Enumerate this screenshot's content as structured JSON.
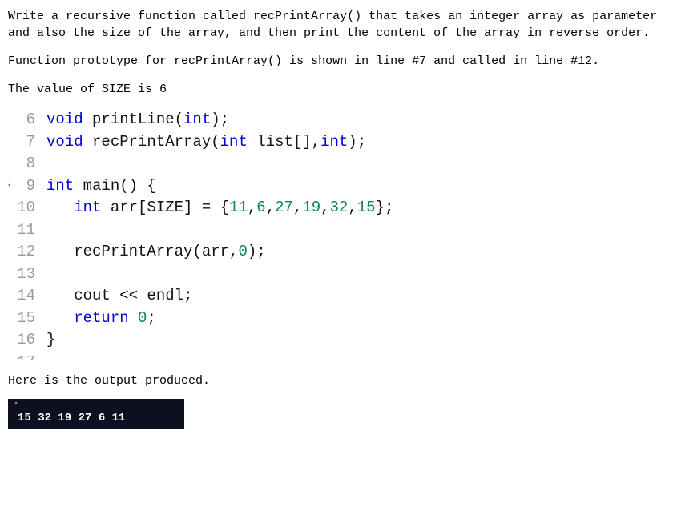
{
  "problem": {
    "p1": "Write a recursive function called recPrintArray() that takes an integer array as parameter and also the size of the array, and then print the content of the array in reverse order.",
    "p2": "Function prototype for recPrintArray() is shown in line #7 and called in line #12.",
    "p3": "The value of SIZE is 6"
  },
  "code": {
    "lines": [
      {
        "n": "6",
        "c": [
          [
            "kw",
            "void"
          ],
          [
            "",
            " printLine("
          ],
          [
            "kw",
            "int"
          ],
          [
            "",
            ");"
          ]
        ]
      },
      {
        "n": "7",
        "c": [
          [
            "kw",
            "void"
          ],
          [
            "",
            " recPrintArray("
          ],
          [
            "kw",
            "int"
          ],
          [
            "",
            " list[],"
          ],
          [
            "kw",
            "int"
          ],
          [
            "",
            ");"
          ]
        ]
      },
      {
        "n": "8",
        "c": [
          [
            "",
            ""
          ]
        ]
      },
      {
        "n": "9",
        "fold": true,
        "c": [
          [
            "kw",
            "int"
          ],
          [
            "",
            " main() {"
          ]
        ]
      },
      {
        "n": "10",
        "c": [
          [
            "",
            "   "
          ],
          [
            "kw",
            "int"
          ],
          [
            "",
            " arr[SIZE] = {"
          ],
          [
            "num",
            "11"
          ],
          [
            "",
            ","
          ],
          [
            "num",
            "6"
          ],
          [
            "",
            ","
          ],
          [
            "num",
            "27"
          ],
          [
            "",
            ","
          ],
          [
            "num",
            "19"
          ],
          [
            "",
            ","
          ],
          [
            "num",
            "32"
          ],
          [
            "",
            ","
          ],
          [
            "num",
            "15"
          ],
          [
            "",
            "};"
          ]
        ]
      },
      {
        "n": "11",
        "c": [
          [
            "",
            ""
          ]
        ]
      },
      {
        "n": "12",
        "c": [
          [
            "",
            "   recPrintArray(arr,"
          ],
          [
            "num",
            "0"
          ],
          [
            "",
            ");"
          ]
        ]
      },
      {
        "n": "13",
        "c": [
          [
            "",
            ""
          ]
        ]
      },
      {
        "n": "14",
        "c": [
          [
            "",
            "   cout << endl;"
          ]
        ]
      },
      {
        "n": "15",
        "c": [
          [
            "",
            "   "
          ],
          [
            "kw",
            "return"
          ],
          [
            "",
            " "
          ],
          [
            "num",
            "0"
          ],
          [
            "",
            ";"
          ]
        ]
      },
      {
        "n": "16",
        "c": [
          [
            "",
            "}"
          ]
        ]
      },
      {
        "n": "17",
        "cut": true,
        "c": [
          [
            "",
            ""
          ]
        ]
      }
    ]
  },
  "output_label": "Here is the output produced.",
  "terminal_output": "15 32 19 27 6 11"
}
